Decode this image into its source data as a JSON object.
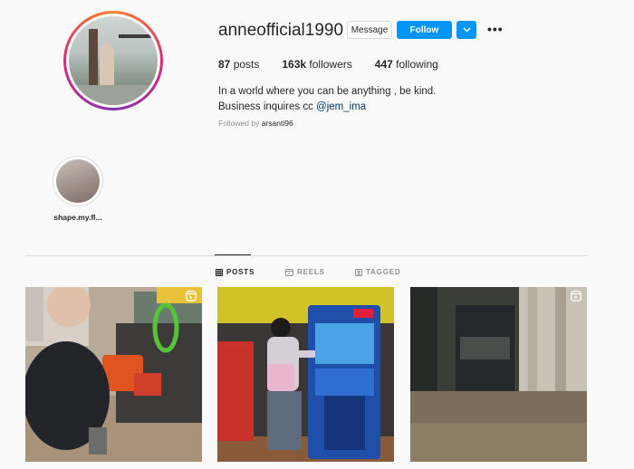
{
  "profile": {
    "username": "anneofficial1990",
    "message_label": "Message",
    "follow_label": "Follow",
    "more_label": "•••",
    "stats": [
      {
        "count": "87",
        "label": " posts"
      },
      {
        "count": "163k",
        "label": " followers"
      },
      {
        "count": "447",
        "label": " following"
      }
    ],
    "bio_line1": "In a world where you can be anything , be kind.",
    "bio_line2_prefix": "Business inquires cc ",
    "bio_mention": "@jem_ima",
    "followed_prefix": "Followed by ",
    "followed_user": "arsanti96"
  },
  "highlights": [
    {
      "label": "shape.my.fl..."
    }
  ],
  "tabs": [
    {
      "label": "POSTS",
      "icon": "grid-icon",
      "active": true
    },
    {
      "label": "REELS",
      "icon": "reels-icon",
      "active": false
    },
    {
      "label": "TAGGED",
      "icon": "tagged-icon",
      "active": false
    }
  ],
  "colors": {
    "accent": "#0095f6",
    "text": "#262626",
    "muted": "#8e8e8e",
    "mention": "#00376b"
  }
}
